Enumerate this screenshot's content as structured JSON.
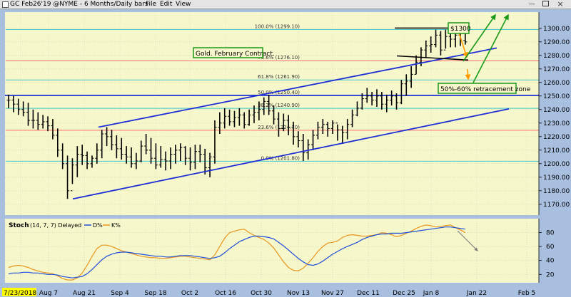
{
  "titlebar": {
    "title": "GC Feb26'19 @NYME - 6 Months/Daily bars",
    "menu": [
      "File",
      "Edit",
      "View"
    ]
  },
  "colors": {
    "chart_bg": "#f7f7cc",
    "frame_bg": "#a9bfe0",
    "titlebar_bg": "#e0e0e0",
    "bars": "#000000",
    "channel": "#1f2fd6",
    "gridline": "#c8c8a8",
    "fib_line": "#40c8c8",
    "fib_red": "#ff6a6a",
    "resistance_black": "#000000",
    "green_annotation": "#1a9a1a",
    "orange_arrow": "#ff9a00",
    "d_line": "#1f4fd8",
    "k_line": "#e8961c",
    "date_highlight": "#ffff00"
  },
  "chart_data": [
    {
      "type": "ohlc",
      "title": "",
      "ylim": [
        1162,
        1312
      ],
      "y_ticks": [
        1170,
        1180,
        1190,
        1200,
        1210,
        1220,
        1230,
        1240,
        1250,
        1260,
        1270,
        1280,
        1290,
        1300
      ],
      "x_labels": [
        "7/23/2018",
        "Aug 7",
        "Aug 21",
        "Sep 4",
        "Sep 18",
        "Oct 2",
        "Oct 16",
        "Oct 30",
        "Nov 13",
        "Nov 27",
        "Dec 11",
        "Dec 25",
        "Jan 8",
        "Jan 22",
        "Feb 5"
      ],
      "fib_levels": [
        {
          "label": "100.0% (1299.10)",
          "value": 1299.1
        },
        {
          "label": "78.6% (1276.10)",
          "value": 1276.1
        },
        {
          "label": "61.8% (1261.90)",
          "value": 1261.9
        },
        {
          "label": "50.0% (1250.40)",
          "value": 1250.4
        },
        {
          "label": "38.2% (1240.90)",
          "value": 1240.9
        },
        {
          "label": "23.6% (1224.70)",
          "value": 1224.7
        },
        {
          "label": "0.0% (1201.80)",
          "value": 1201.8
        }
      ],
      "annotations": [
        "Gold. February Contract.",
        "$1300",
        "50%-60% retracement zone"
      ],
      "channel_lines": [
        {
          "from": [
            "Aug 14",
            1175
          ],
          "to": [
            "Jan 18",
            1240
          ]
        },
        {
          "from": [
            "Aug 29",
            1227
          ],
          "to": [
            "Jan 18",
            1285
          ]
        }
      ],
      "horizontal_line": 1250.5,
      "ohlc": [
        [
          1251,
          1241,
          1247
        ],
        [
          1250,
          1238,
          1244
        ],
        [
          1248,
          1236,
          1240
        ],
        [
          1246,
          1235,
          1238
        ],
        [
          1245,
          1228,
          1232
        ],
        [
          1240,
          1226,
          1232
        ],
        [
          1238,
          1225,
          1229
        ],
        [
          1236,
          1226,
          1231
        ],
        [
          1235,
          1224,
          1228
        ],
        [
          1233,
          1218,
          1221
        ],
        [
          1226,
          1205,
          1210
        ],
        [
          1215,
          1196,
          1200
        ],
        [
          1206,
          1174,
          1180
        ],
        [
          1204,
          1185,
          1199
        ],
        [
          1213,
          1190,
          1207
        ],
        [
          1214,
          1199,
          1206
        ],
        [
          1209,
          1196,
          1200
        ],
        [
          1206,
          1197,
          1204
        ],
        [
          1215,
          1200,
          1210
        ],
        [
          1225,
          1204,
          1222
        ],
        [
          1227,
          1213,
          1220
        ],
        [
          1225,
          1210,
          1214
        ],
        [
          1221,
          1204,
          1211
        ],
        [
          1219,
          1203,
          1207
        ],
        [
          1213,
          1200,
          1205
        ],
        [
          1212,
          1197,
          1200
        ],
        [
          1208,
          1196,
          1202
        ],
        [
          1217,
          1201,
          1213
        ],
        [
          1222,
          1207,
          1210
        ],
        [
          1219,
          1200,
          1204
        ],
        [
          1215,
          1196,
          1199
        ],
        [
          1213,
          1197,
          1203
        ],
        [
          1209,
          1195,
          1202
        ],
        [
          1212,
          1196,
          1207
        ],
        [
          1214,
          1200,
          1210
        ],
        [
          1215,
          1202,
          1212
        ],
        [
          1213,
          1199,
          1204
        ],
        [
          1212,
          1195,
          1201
        ],
        [
          1214,
          1196,
          1209
        ],
        [
          1214,
          1201,
          1207
        ],
        [
          1211,
          1192,
          1197
        ],
        [
          1208,
          1190,
          1205
        ],
        [
          1232,
          1200,
          1227
        ],
        [
          1238,
          1222,
          1230
        ],
        [
          1241,
          1226,
          1235
        ],
        [
          1240,
          1228,
          1231
        ],
        [
          1239,
          1227,
          1234
        ],
        [
          1241,
          1228,
          1236
        ],
        [
          1238,
          1226,
          1229
        ],
        [
          1240,
          1228,
          1236
        ],
        [
          1243,
          1230,
          1238
        ],
        [
          1246,
          1232,
          1240
        ],
        [
          1249,
          1236,
          1246
        ],
        [
          1251,
          1236,
          1239
        ],
        [
          1243,
          1229,
          1233
        ],
        [
          1238,
          1220,
          1226
        ],
        [
          1237,
          1224,
          1232
        ],
        [
          1236,
          1221,
          1227
        ],
        [
          1231,
          1214,
          1220
        ],
        [
          1224,
          1212,
          1217
        ],
        [
          1222,
          1202,
          1208
        ],
        [
          1218,
          1203,
          1214
        ],
        [
          1225,
          1210,
          1221
        ],
        [
          1231,
          1218,
          1227
        ],
        [
          1233,
          1222,
          1229
        ],
        [
          1231,
          1220,
          1226
        ],
        [
          1232,
          1222,
          1230
        ],
        [
          1229,
          1217,
          1225
        ],
        [
          1228,
          1215,
          1223
        ],
        [
          1233,
          1218,
          1229
        ],
        [
          1240,
          1227,
          1236
        ],
        [
          1246,
          1235,
          1241
        ],
        [
          1252,
          1240,
          1248
        ],
        [
          1256,
          1245,
          1250
        ],
        [
          1253,
          1243,
          1247
        ],
        [
          1255,
          1242,
          1250
        ],
        [
          1253,
          1240,
          1244
        ],
        [
          1251,
          1238,
          1247
        ],
        [
          1254,
          1243,
          1250
        ],
        [
          1252,
          1240,
          1245
        ],
        [
          1262,
          1244,
          1259
        ],
        [
          1266,
          1250,
          1261
        ],
        [
          1272,
          1256,
          1266
        ],
        [
          1280,
          1266,
          1275
        ],
        [
          1286,
          1272,
          1284
        ],
        [
          1291,
          1278,
          1287
        ],
        [
          1294,
          1282,
          1288
        ],
        [
          1299,
          1286,
          1295
        ],
        [
          1298,
          1280,
          1284
        ],
        [
          1299,
          1285,
          1294
        ],
        [
          1301,
          1286,
          1292
        ],
        [
          1300,
          1286,
          1295
        ],
        [
          1299,
          1287,
          1291
        ],
        [
          1296,
          1288,
          1290
        ]
      ]
    },
    {
      "type": "line",
      "title": "Stoch",
      "params": "(14, 7, 7) Delayed",
      "series": [
        {
          "name": "D%",
          "values": [
            21,
            22,
            22,
            23,
            23,
            22,
            22,
            21,
            20,
            20,
            19,
            17,
            16,
            15,
            16,
            17,
            21,
            27,
            34,
            41,
            46,
            49,
            51,
            52,
            52,
            51,
            50,
            49,
            48,
            47,
            46,
            46,
            45,
            45,
            46,
            47,
            47,
            47,
            46,
            45,
            44,
            43,
            44,
            46,
            51,
            57,
            62,
            67,
            70,
            73,
            75,
            75,
            74,
            73,
            71,
            66,
            61,
            55,
            49,
            43,
            38,
            34,
            33,
            35,
            39,
            44,
            49,
            53,
            57,
            60,
            63,
            66,
            70,
            73,
            75,
            77,
            78,
            78,
            79,
            79,
            79,
            80,
            81,
            82,
            83,
            84,
            85,
            86,
            87,
            88,
            88,
            87,
            86,
            85
          ]
        },
        {
          "name": "K%",
          "values": [
            30,
            32,
            33,
            32,
            30,
            27,
            25,
            23,
            22,
            21,
            18,
            14,
            12,
            12,
            15,
            22,
            33,
            46,
            57,
            62,
            62,
            60,
            57,
            54,
            52,
            50,
            48,
            46,
            45,
            44,
            44,
            43,
            43,
            44,
            45,
            46,
            46,
            45,
            44,
            43,
            42,
            41,
            48,
            60,
            72,
            80,
            82,
            84,
            85,
            80,
            76,
            73,
            70,
            65,
            58,
            48,
            38,
            30,
            26,
            25,
            29,
            36,
            44,
            53,
            60,
            65,
            66,
            68,
            73,
            76,
            77,
            76,
            75,
            75,
            76,
            77,
            80,
            79,
            77,
            74,
            76,
            79,
            82,
            86,
            89,
            91,
            90,
            88,
            89,
            90,
            91,
            87,
            84,
            80
          ]
        }
      ],
      "ylim": [
        8,
        100
      ],
      "y_ticks": [
        20,
        40,
        60,
        80
      ]
    }
  ],
  "stoch_legend": {
    "label": "Stoch",
    "params": "(14, 7, 7) Delayed",
    "d_name": "D%",
    "k_name": "K%"
  },
  "window_buttons": [
    "minimize",
    "restore",
    "close"
  ]
}
